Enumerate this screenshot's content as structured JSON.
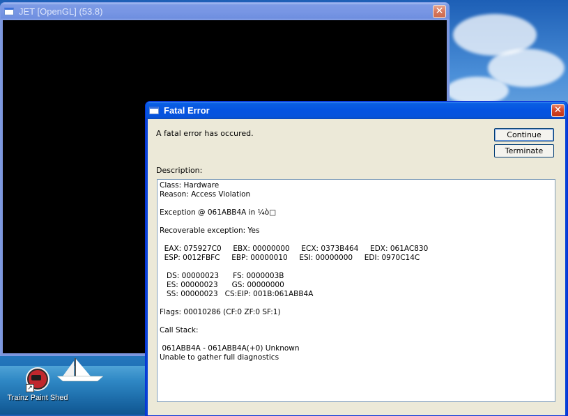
{
  "desktop": {
    "icon_label": "Trainz Paint Shed"
  },
  "jet_window": {
    "title": "JET [OpenGL]   (53.8)",
    "close_glyph": "✕"
  },
  "fatal_window": {
    "title": "Fatal Error",
    "close_glyph": "✕",
    "message": "A fatal error has occured.",
    "description_label": "Description:",
    "continue_label": "Continue",
    "terminate_label": "Terminate",
    "description_text": "Class: Hardware\nReason: Access Violation\n\nException @ 061ABB4A in ¼ò□\n\nRecoverable exception: Yes\n\n  EAX: 075927C0     EBX: 00000000     ECX: 0373B464     EDX: 061AC830\n  ESP: 0012FBFC     EBP: 00000010     ESI: 00000000     EDI: 0970C14C\n\n   DS: 00000023      FS: 0000003B\n   ES: 00000023      GS: 00000000\n   SS: 00000023   CS:EIP: 001B:061ABB4A\n\nFlags: 00010286 (CF:0 ZF:0 SF:1)\n\nCall Stack:\n\n 061ABB4A - 061ABB4A(+0) Unknown\nUnable to gather full diagnostics"
  },
  "colors": {
    "titlebar_active": "#0553e1",
    "titlebar_inactive": "#7896e4",
    "dialog_face": "#ece9d8",
    "close_red": "#d6482b"
  }
}
